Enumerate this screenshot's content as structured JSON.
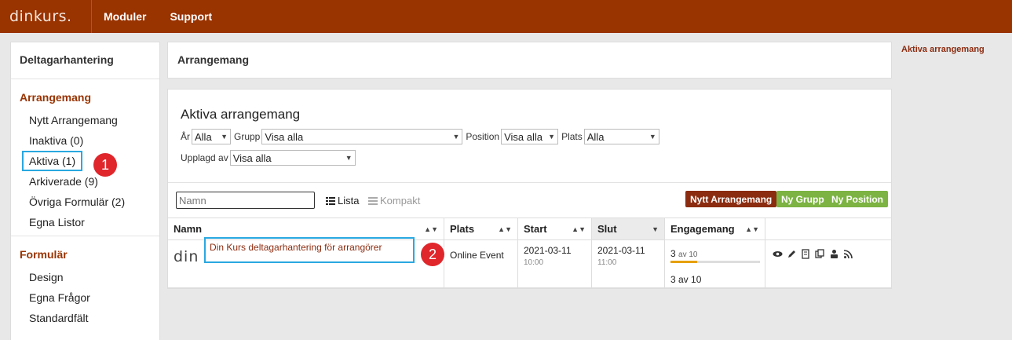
{
  "topbar": {
    "logo": "dinkurs.",
    "nav": [
      "Moduler",
      "Support"
    ],
    "color": "#993300"
  },
  "sidebar": {
    "title": "Deltagarhantering",
    "sections": [
      {
        "title": "Arrangemang",
        "items": [
          "Nytt Arrangemang",
          "Inaktiva (0)",
          "Aktiva (1)",
          "Arkiverade (9)",
          "Övriga Formulär (2)",
          "Egna Listor"
        ]
      },
      {
        "title": "Formulär",
        "items": [
          "Design",
          "Egna Frågor",
          "Standardfält"
        ]
      }
    ]
  },
  "badges": [
    "1",
    "2"
  ],
  "main": {
    "header": "Arrangemang",
    "panel_title": "Aktiva arrangemang",
    "filters": {
      "year_label": "År",
      "year_value": "Alla",
      "group_label": "Grupp",
      "group_value": "Visa alla",
      "position_label": "Position",
      "position_value": "Visa alla",
      "place_label": "Plats",
      "place_value": "Alla",
      "uploaded_label": "Upplagd av",
      "uploaded_value": "Visa alla"
    },
    "search_placeholder": "Namn",
    "views": [
      "Lista",
      "Kompakt"
    ],
    "buttons": {
      "new_event": "Nytt Arrangemang",
      "new_group": "Ny Grupp",
      "new_position": "Ny Position"
    },
    "table": {
      "headers": [
        "Namn",
        "Plats",
        "Start",
        "Slut",
        "Engagemang"
      ],
      "rows": [
        {
          "thumb": "din",
          "name": "Din Kurs deltagarhantering för arrangörer",
          "place": "Online Event",
          "start_date": "2021-03-11",
          "start_time": "10:00",
          "end_date": "2021-03-11",
          "end_time": "11:00",
          "eng_count": "3",
          "eng_of": "av 10",
          "eng_total": "3 av 10",
          "eng_fraction": 0.3
        }
      ]
    }
  },
  "right": {
    "link": "Aktiva arrangemang"
  }
}
